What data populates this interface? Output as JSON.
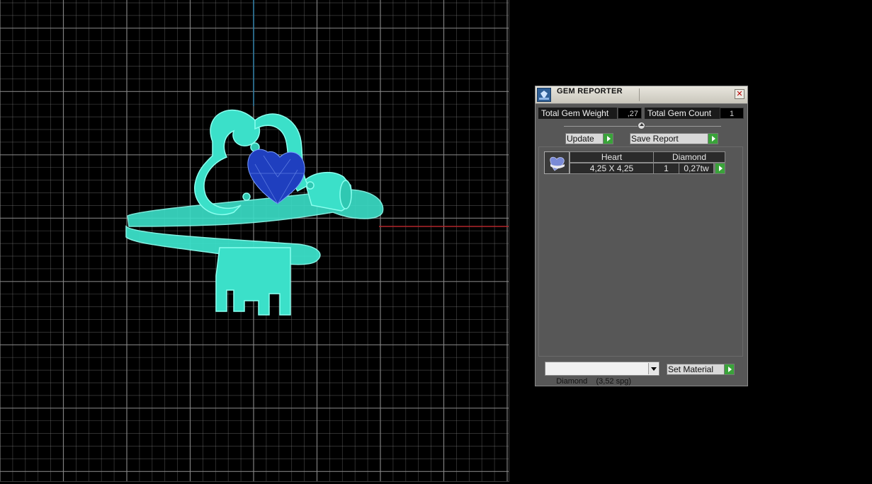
{
  "viewport": {
    "grid_color": "#8c8c8c",
    "axis_x_color": "#b3262a",
    "axis_y_color": "#2d7ea6",
    "model_color": "#3be0c9",
    "gem_color": "#1f3fbf"
  },
  "panel": {
    "title": "GEM REPORTER",
    "close_glyph": "✕",
    "total_weight_label": "Total Gem Weight",
    "total_weight_value": ",27",
    "total_count_label": "Total Gem Count",
    "total_count_value": "1",
    "update_label": "Update",
    "save_report_label": "Save Report"
  },
  "gem_row": {
    "shape_header": "Heart",
    "material_header": "Diamond",
    "size": "4,25 X 4,25",
    "count": "1",
    "weight": "0,27tw"
  },
  "material": {
    "selected": "Diamond    (3,52 spg)",
    "set_label": "Set Material"
  }
}
